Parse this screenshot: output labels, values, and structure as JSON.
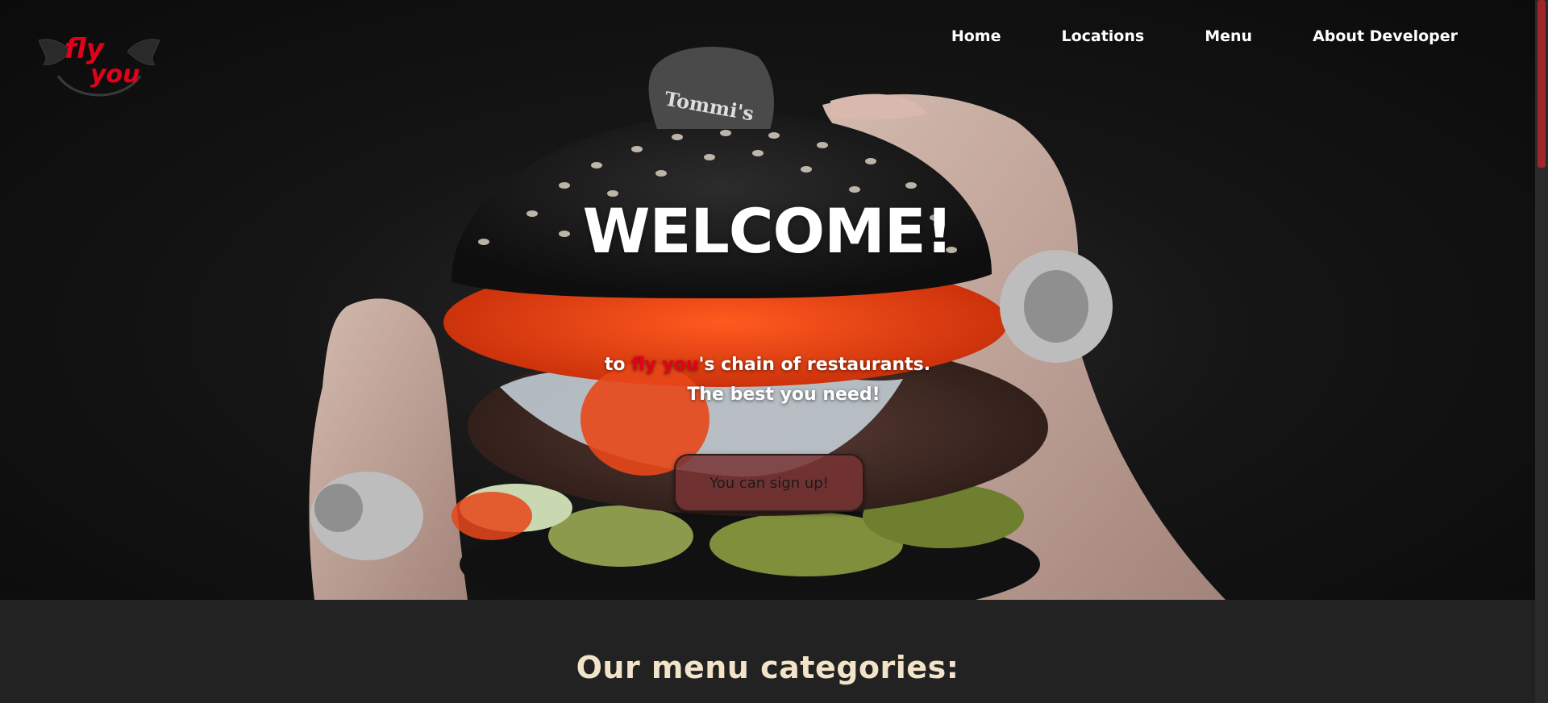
{
  "brand": {
    "logo_top": "fly",
    "logo_bottom": "you",
    "accent_color": "#e3001b"
  },
  "nav": {
    "items": [
      {
        "label": "Home"
      },
      {
        "label": "Locations"
      },
      {
        "label": "Menu"
      },
      {
        "label": "About Developer"
      }
    ]
  },
  "hero": {
    "title": "WELCOME!",
    "tagline_prefix": "to ",
    "tagline_brand": "fly you",
    "tagline_suffix": "'s chain of restaurants.",
    "tagline_line2": "The best you need!",
    "signup_label": "You can sign up!",
    "image_text": "Tommi's"
  },
  "categories": {
    "title": "Our menu categories:"
  },
  "colors": {
    "page_bg": "#222222",
    "categories_title": "#f3e3c9",
    "button_bg": "#783434",
    "scroll_thumb": "#a1262c"
  }
}
